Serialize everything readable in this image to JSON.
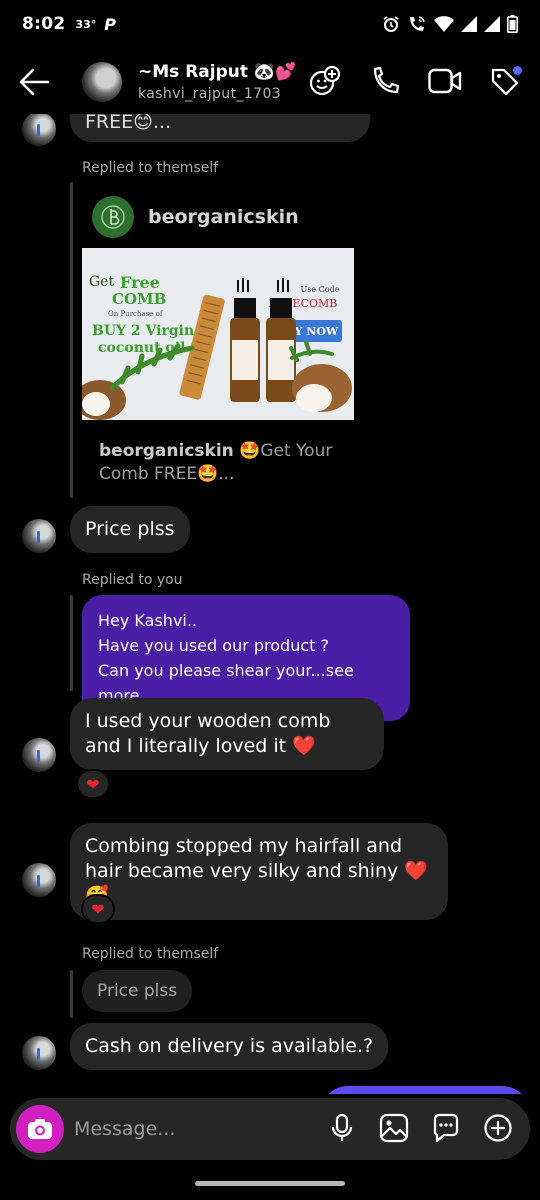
{
  "status_bar": {
    "time": "8:02",
    "temperature": "33°",
    "app_badge": "P",
    "icons": [
      "alarm-icon",
      "wifi-calling-icon",
      "wifi-icon",
      "signal-icon",
      "signal-icon",
      "battery-icon"
    ]
  },
  "header": {
    "display_name": "~Ms Rajput 🐼💕",
    "username": "kashvi_rajput_1703",
    "icons": [
      "effects-icon",
      "phone-icon",
      "video-icon",
      "tag-icon"
    ],
    "badge_color": "#5b6bff"
  },
  "messages": {
    "top_partial": "FREE😊...",
    "reply1_label": "Replied to themself",
    "post": {
      "account": "beorganicskin",
      "image_text": {
        "get": "Get",
        "free": "Free",
        "comb": "COMB",
        "on_purchase": "On Purchase of",
        "buy2": "BUY 2 Virgin",
        "coconut_oil": "coconut oil",
        "use_code": "Use Code",
        "code": "FREECOMB",
        "buy_now": "BUY NOW"
      },
      "caption_account": "beorganicskin",
      "caption_text": " 🤩Get Your Comb FREE🤩..."
    },
    "msg_price": "Price plss",
    "reply2_label": "Replied to you",
    "purple_line1": "Hey Kashvi..",
    "purple_line2": "Have you used our product ?",
    "purple_line3": "Can you please shear your...",
    "purple_more": "see more",
    "msg_comb": "I used your wooden comb and I literally loved it ❤️",
    "reaction1": "❤",
    "msg_combing": "Combing stopped my  hairfall and hair became very silky and shiny ❤️🥰",
    "reaction2": "❤",
    "reply3_label": "Replied to themself",
    "quoted_text": "Price plss",
    "msg_cod": "Cash on delivery is available.?"
  },
  "composer": {
    "placeholder": "Message...",
    "camera_color": "#d21fc0",
    "icons": [
      "microphone-icon",
      "gallery-icon",
      "sticker-icon",
      "add-icon"
    ]
  },
  "colors": {
    "background": "#000000",
    "bubble": "#262626",
    "outgoing_bubble": "#4a1fa5",
    "own_bubble": "#5b4cf0",
    "heart": "#e3262f"
  }
}
